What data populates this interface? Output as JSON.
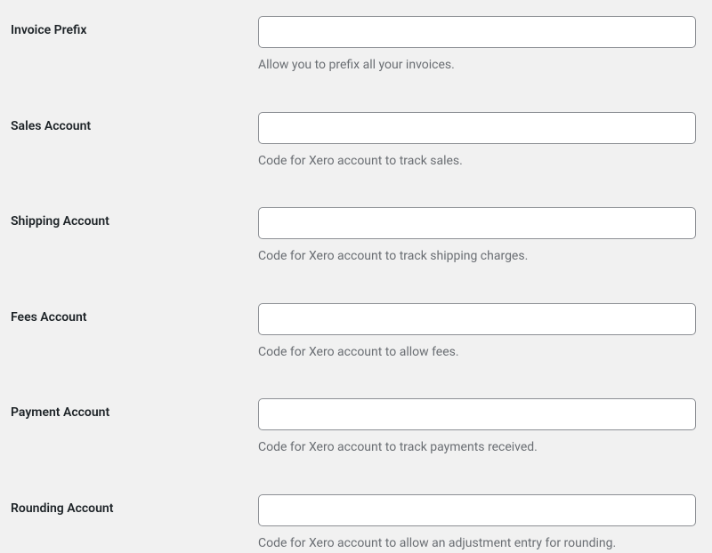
{
  "fields": {
    "invoicePrefix": {
      "label": "Invoice Prefix",
      "value": "",
      "description": "Allow you to prefix all your invoices."
    },
    "salesAccount": {
      "label": "Sales Account",
      "value": "",
      "description": "Code for Xero account to track sales."
    },
    "shippingAccount": {
      "label": "Shipping Account",
      "value": "",
      "description": "Code for Xero account to track shipping charges."
    },
    "feesAccount": {
      "label": "Fees Account",
      "value": "",
      "description": "Code for Xero account to allow fees."
    },
    "paymentAccount": {
      "label": "Payment Account",
      "value": "",
      "description": "Code for Xero account to track payments received."
    },
    "roundingAccount": {
      "label": "Rounding Account",
      "value": "",
      "description": "Code for Xero account to allow an adjustment entry for rounding."
    }
  }
}
